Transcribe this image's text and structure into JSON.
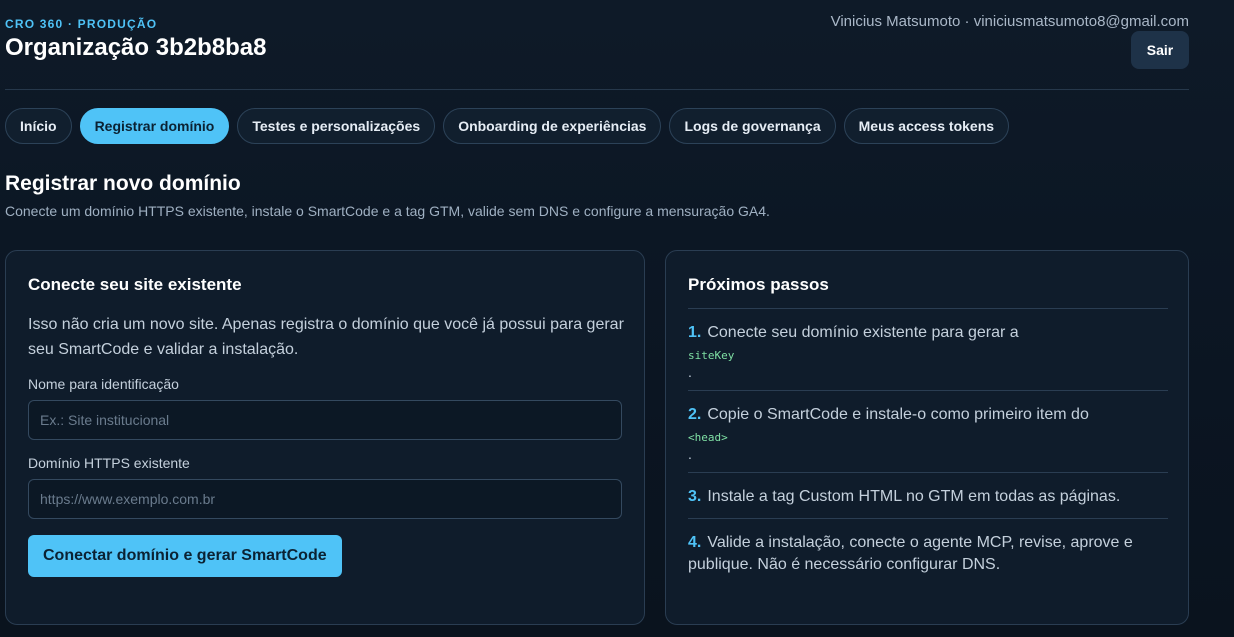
{
  "header": {
    "eyebrow": "CRO 360 · PRODUÇÃO",
    "org_title": "Organização 3b2b8ba8",
    "user": "Vinicius Matsumoto · viniciusmatsumoto8@gmail.com",
    "logout_label": "Sair"
  },
  "tabs": [
    {
      "label": "Início",
      "active": false
    },
    {
      "label": "Registrar domínio",
      "active": true
    },
    {
      "label": "Testes e personalizações",
      "active": false
    },
    {
      "label": "Onboarding de experiências",
      "active": false
    },
    {
      "label": "Logs de governança",
      "active": false
    },
    {
      "label": "Meus access tokens",
      "active": false
    }
  ],
  "section": {
    "title": "Registrar novo domínio",
    "subtitle": "Conecte um domínio HTTPS existente, instale o SmartCode e a tag GTM, valide sem DNS e configure a mensuração GA4."
  },
  "connect_card": {
    "title": "Conecte seu site existente",
    "description": "Isso não cria um novo site. Apenas registra o domínio que você já possui para gerar seu SmartCode e validar a instalação.",
    "name_label": "Nome para identificação",
    "name_placeholder": "Ex.: Site institucional",
    "name_value": "",
    "domain_label": "Domínio HTTPS existente",
    "domain_placeholder": "https://www.exemplo.com.br",
    "domain_value": "",
    "submit_label": "Conectar domínio e gerar SmartCode"
  },
  "next_steps": {
    "title": "Próximos passos",
    "steps": [
      {
        "num": "1.",
        "text": "Conecte seu domínio existente para gerar a",
        "code": "siteKey",
        "tail": "."
      },
      {
        "num": "2.",
        "text": "Copie o SmartCode e instale-o como primeiro item do",
        "code": "<head>",
        "tail": "."
      },
      {
        "num": "3.",
        "text": "Instale a tag Custom HTML no GTM em todas as páginas.",
        "code": "",
        "tail": ""
      },
      {
        "num": "4.",
        "text": "Valide a instalação, conecte o agente MCP, revise, aprove e publique. Não é necessário configurar DNS.",
        "code": "",
        "tail": ""
      }
    ]
  },
  "colors": {
    "accent": "#4fc3f7",
    "background": "#0c1724",
    "card": "#0f1c2b",
    "code": "#7fe0a4"
  }
}
